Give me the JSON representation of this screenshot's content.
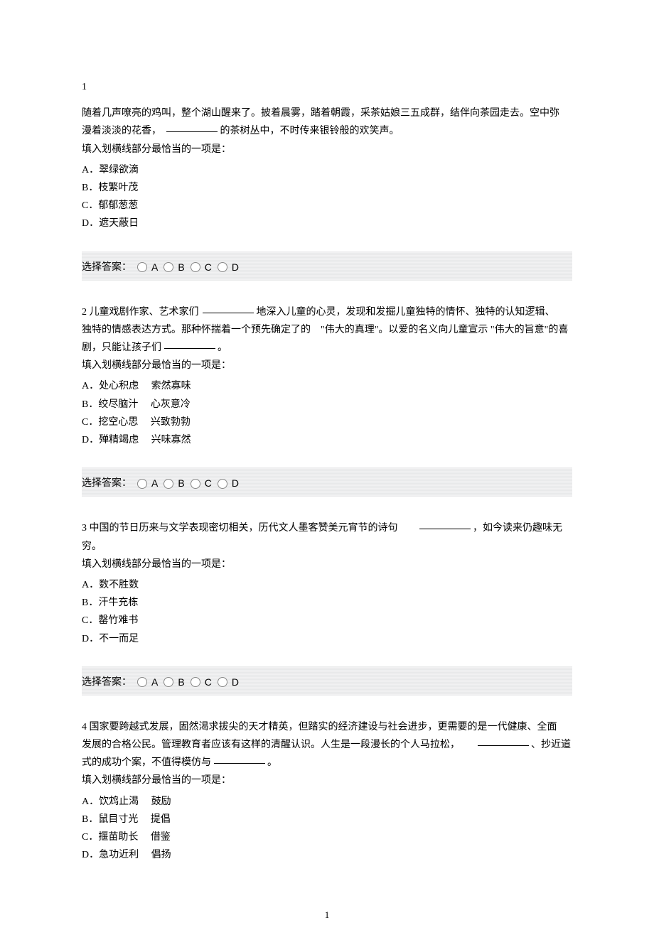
{
  "page_number": "1",
  "questions": [
    {
      "number": "1",
      "pre": "",
      "lines": [
        "随着几声嘹亮的鸡叫，整个湖山醒来了。披着晨雾，踏着朝霞，采茶姑娘三五成群，结伴向茶园走去。空中弥",
        "漫着淡淡的花香，"
      ],
      "after_blank": " 的茶树丛中，不时传来银铃般的欢笑声。",
      "prompt": "填入划横线部分最恰当的一项是：",
      "options": [
        "A．翠绿欲滴",
        "B．枝繁叶茂",
        "C．郁郁葱葱",
        "D．遮天蔽日"
      ]
    },
    {
      "number": "2",
      "pre": " 儿童戏剧作家、艺术家们 ",
      "lines": [],
      "after_blank": " 地深入儿童的心灵，发现和发掘儿童独特的情怀、独特的认知逻辑、",
      "line2_pre": "独特的情感表达方式。那种怀揣着一个预先确定了的　\"伟大的真理\"。以爱的名义向儿童宣示 \"伟大的旨意\"的喜",
      "line3_pre": "剧，只能让孩子们 ",
      "line3_after": " 。",
      "prompt": "填入划横线部分最恰当的一项是：",
      "options": [
        "A．处心积虑　 索然寡味",
        "B．绞尽脑汁　 心灰意冷",
        "C．挖空心思　 兴致勃勃",
        "D．殚精竭虑　 兴味寡然"
      ]
    },
    {
      "number": "3",
      "pre": " 中国的节日历来与文学表现密切相关，历代文人墨客赞美元宵节的诗句　　",
      "lines": [],
      "after_blank": " ，如今读来仍趣味无穷。",
      "prompt": "填入划横线部分最恰当的一项是：",
      "options": [
        "A．数不胜数",
        "B．汗牛充栋",
        "C．罄竹难书",
        "D．不一而足"
      ]
    },
    {
      "number": "4",
      "pre": " 国家要跨越式发展，固然渴求拔尖的天才精英，但踏实的经济建设与社会进步，更需要的是一代健康、全面",
      "lines": [],
      "line2_pre": "发展的合格公民。管理教育者应该有这样的清醒认识。人生是一段漫长的个人马拉松，　　 ",
      "line2_after": " 、抄近道",
      "line3_pre": "式的成功个案，不值得模仿与 ",
      "line3_after": " 。",
      "prompt": "填入划横线部分最恰当的一项是：",
      "options": [
        "A．饮鸩止渴　 鼓励",
        "B．鼠目寸光　 提倡",
        "C．揠苗助长　 借鉴",
        "D．急功近利　 倡扬"
      ]
    }
  ],
  "answer_label": "选择答案：",
  "radio_letters": [
    "A",
    "B",
    "C",
    "D"
  ]
}
